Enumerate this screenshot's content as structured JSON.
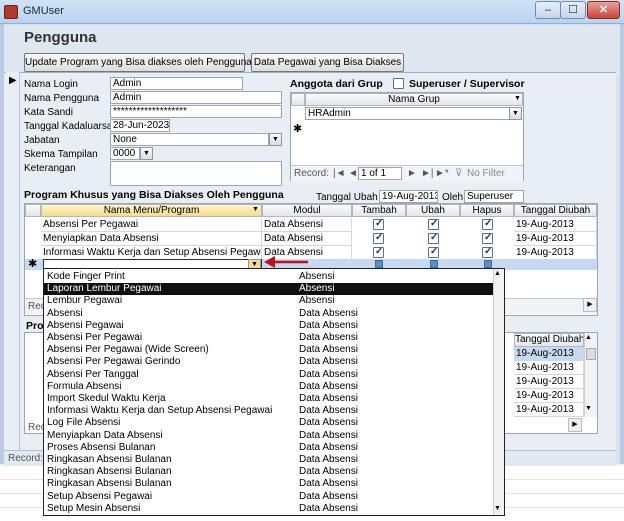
{
  "window": {
    "title": "GMUser",
    "min": "–",
    "max": "☐",
    "close": "✕"
  },
  "form": {
    "title": "Pengguna"
  },
  "buttons": {
    "update_program": "Update Program yang Bisa diakses oleh Pengguna",
    "data_pegawai": "Data Pegawai yang Bisa Diakses"
  },
  "fields": {
    "nama_login": {
      "label": "Nama Login",
      "value": "Admin"
    },
    "nama_pengguna": {
      "label": "Nama Pengguna",
      "value": "Admin"
    },
    "kata_sandi": {
      "label": "Kata Sandi",
      "value": "*******************"
    },
    "tanggal_kadaluarsa": {
      "label": "Tanggal Kadaluarsa",
      "value": "28-Jun-2023"
    },
    "jabatan": {
      "label": "Jabatan",
      "value": "None"
    },
    "skema_tampilan": {
      "label": "Skema Tampilan",
      "value": "0000"
    },
    "keterangan": {
      "label": "Keterangan",
      "value": ""
    }
  },
  "grup": {
    "title": "Anggota dari Grup",
    "superuser_label": "Superuser / Supervisor",
    "superuser_checked": false,
    "column": "Nama Grup",
    "rows": [
      "HRAdmin"
    ],
    "nav": {
      "record_label": "Record:",
      "first": "|◄",
      "prev": "◄",
      "position": "1 of 1",
      "next": "►",
      "last": "►|",
      "new": "►*",
      "filter": "No Filter"
    }
  },
  "program": {
    "title": "Program Khusus yang Bisa Diakses Oleh Pengguna",
    "tanggal_ubah_label": "Tanggal Ubah",
    "tanggal_ubah_value": "19-Aug-2013",
    "oleh_label": "Oleh",
    "oleh_value": "Superuser",
    "columns": [
      "Nama Menu/Program",
      "Modul",
      "Tambah",
      "Ubah",
      "Hapus",
      "Tanggal Diubah"
    ],
    "rows": [
      {
        "nama": "Absensi Per Pegawai",
        "modul": "Data Absensi",
        "tambah": true,
        "ubah": true,
        "hapus": true,
        "tanggal": "19-Aug-2013"
      },
      {
        "nama": "Menyiapkan Data Absensi",
        "modul": "Data Absensi",
        "tambah": true,
        "ubah": true,
        "hapus": true,
        "tanggal": "19-Aug-2013"
      },
      {
        "nama": "Informasi Waktu Kerja dan Setup Absensi Pegawai",
        "modul": "Data Absensi",
        "tambah": true,
        "ubah": true,
        "hapus": true,
        "tanggal": "19-Aug-2013"
      }
    ],
    "record_label": "Rec"
  },
  "program2": {
    "title": "Pro",
    "column": "Tanggal Diubah",
    "dates": [
      "19-Aug-2013",
      "19-Aug-2013",
      "19-Aug-2013",
      "19-Aug-2013",
      "19-Aug-2013"
    ],
    "record_label": "Rec"
  },
  "status": {
    "record_label": "Record:"
  },
  "dropdown_list": [
    {
      "name": "Kode Finger Print",
      "module": "Absensi"
    },
    {
      "name": "Laporan Lembur Pegawai",
      "module": "Absensi"
    },
    {
      "name": "Lembur Pegawai",
      "module": "Absensi"
    },
    {
      "name": "Absensi",
      "module": "Data Absensi"
    },
    {
      "name": "Absensi Pegawai",
      "module": "Data Absensi"
    },
    {
      "name": "Absensi Per Pegawai",
      "module": "Data Absensi"
    },
    {
      "name": "Absensi Per Pegawai (Wide Screen)",
      "module": "Data Absensi"
    },
    {
      "name": "Absensi Per Pegawai Gerindo",
      "module": "Data Absensi"
    },
    {
      "name": "Absensi Per Tanggal",
      "module": "Data Absensi"
    },
    {
      "name": "Formula Absensi",
      "module": "Data Absensi"
    },
    {
      "name": "Import Skedul Waktu Kerja",
      "module": "Data Absensi"
    },
    {
      "name": "Informasi Waktu Kerja dan Setup Absensi Pegawai",
      "module": "Data Absensi"
    },
    {
      "name": "Log File Absensi",
      "module": "Data Absensi"
    },
    {
      "name": "Menyiapkan Data Absensi",
      "module": "Data Absensi"
    },
    {
      "name": "Proses Absensi Bulanan",
      "module": "Data Absensi"
    },
    {
      "name": "Ringkasan Absensi Bulanan",
      "module": "Data Absensi"
    },
    {
      "name": "Ringkasan Absensi Bulanan",
      "module": "Data Absensi"
    },
    {
      "name": "Ringkasan Absensi Bulanan",
      "module": "Data Absensi"
    },
    {
      "name": "Setup Absensi Pegawai",
      "module": "Data Absensi"
    },
    {
      "name": "Setup Mesin Absensi",
      "module": "Data Absensi"
    }
  ],
  "dropdown_selected_index": 1,
  "colors": {
    "accent_arrow": "#c0101a",
    "selected_row_bg": "#0f0f0f",
    "title_bar": "#cfe3f6"
  }
}
